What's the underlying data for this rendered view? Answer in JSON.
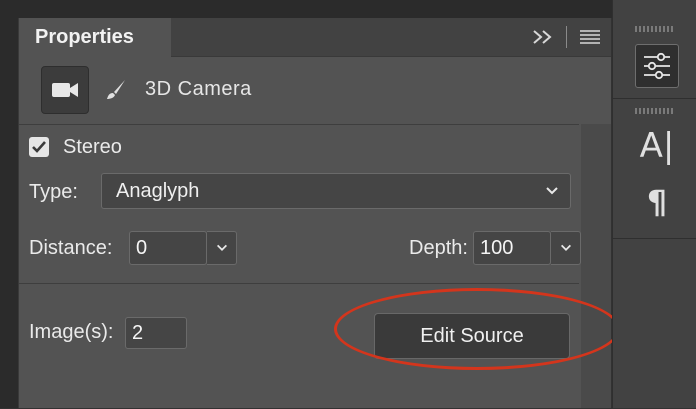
{
  "panel": {
    "title": "Properties",
    "expand_icon": "double-chevron-right-icon",
    "menu_icon": "hamburger-menu-icon"
  },
  "camera": {
    "camera_icon": "video-camera-icon",
    "brush_icon": "paintbrush-icon",
    "label": "3D Camera"
  },
  "stereo": {
    "checked": true,
    "label": "Stereo"
  },
  "type": {
    "label": "Type:",
    "value": "Anaglyph"
  },
  "distance": {
    "label": "Distance:",
    "value": "0"
  },
  "depth": {
    "label": "Depth:",
    "value": "100"
  },
  "images": {
    "label": "Image(s):",
    "value": "2"
  },
  "edit_source": {
    "label": "Edit Source"
  },
  "right_toolbar": {
    "character_glyph": "A|",
    "paragraph_glyph": "¶"
  },
  "colors": {
    "highlight": "#d4351c",
    "panel_bg": "#535353"
  }
}
